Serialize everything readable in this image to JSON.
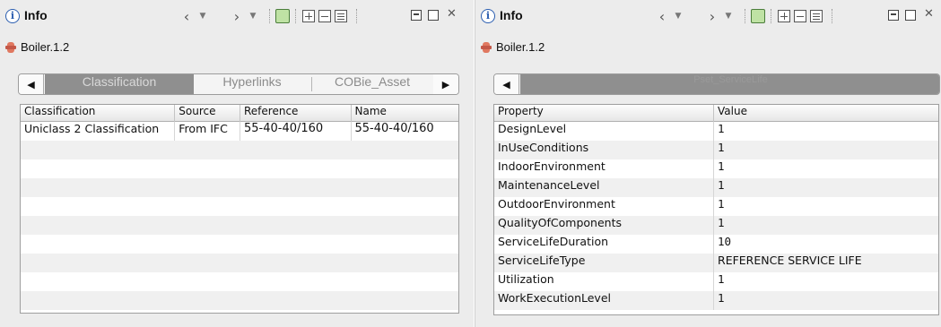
{
  "left_panel": {
    "title": "Info",
    "toolbar": {
      "back_icon": "chevron-left-icon",
      "forward_icon": "chevron-right-icon"
    },
    "breadcrumb": "Boiler.1.2",
    "tabs": [
      {
        "label": "Classification",
        "active": true
      },
      {
        "label": "Hyperlinks",
        "active": false
      },
      {
        "label": "COBie_Asset",
        "active": false
      }
    ],
    "table": {
      "columns": [
        "Classification",
        "Source",
        "Reference",
        "Name"
      ],
      "rows": [
        [
          "Uniclass 2 Classification",
          "From IFC",
          "55-40-40/160",
          "55-40-40/160"
        ]
      ]
    }
  },
  "right_panel": {
    "title": "Info",
    "breadcrumb": "Boiler.1.2",
    "tabs": [
      {
        "label": "Pset_ServiceLife",
        "active": true
      }
    ],
    "table": {
      "columns": [
        "Property",
        "Value"
      ],
      "rows": [
        [
          "DesignLevel",
          "1"
        ],
        [
          "InUseConditions",
          "1"
        ],
        [
          "IndoorEnvironment",
          "1"
        ],
        [
          "MaintenanceLevel",
          "1"
        ],
        [
          "OutdoorEnvironment",
          "1"
        ],
        [
          "QualityOfComponents",
          "1"
        ],
        [
          "ServiceLifeDuration",
          "10"
        ],
        [
          "ServiceLifeType",
          "REFERENCE SERVICE LIFE"
        ],
        [
          "Utilization",
          "1"
        ],
        [
          "WorkExecutionLevel",
          "1"
        ]
      ]
    }
  },
  "colors": {
    "active_tab": "#8f8f8f",
    "info_icon": "#2a5db0",
    "boiler_icon": "#e07860"
  }
}
